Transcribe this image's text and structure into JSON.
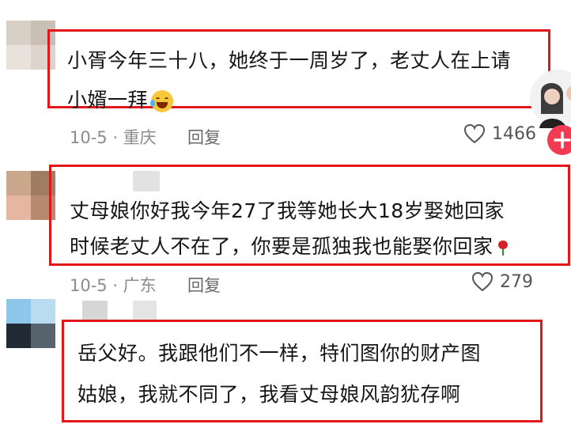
{
  "comments": [
    {
      "lines": [
        "小胥今年三十八，她终于一周岁了，老丈人在上请",
        "小婿一拜"
      ],
      "emoji": "smile-tear-emoji",
      "meta": "10-5 · 重庆",
      "reply_label": "回复",
      "likes": "1466"
    },
    {
      "lines": [
        "丈母娘你好我今年27了我等她长大18岁娶她回家",
        "时候老丈人不在了，你要是孤独我也能娶你回家"
      ],
      "emoji": "rose-emoji",
      "meta": "10-5 · 广东",
      "reply_label": "回复",
      "likes": "279"
    },
    {
      "lines": [
        "岳父好。我跟他们不一样，特们图你的财产图",
        "姑娘，我就不同了，我看丈母娘风韵犹存啊"
      ],
      "meta": "",
      "reply_label": "",
      "likes": ""
    }
  ],
  "side_button": {
    "icon": "plus-icon"
  },
  "colors": {
    "highlight_box": "#e3161a",
    "follow_button": "#f23a52",
    "meta_text": "#8c8c8c"
  }
}
